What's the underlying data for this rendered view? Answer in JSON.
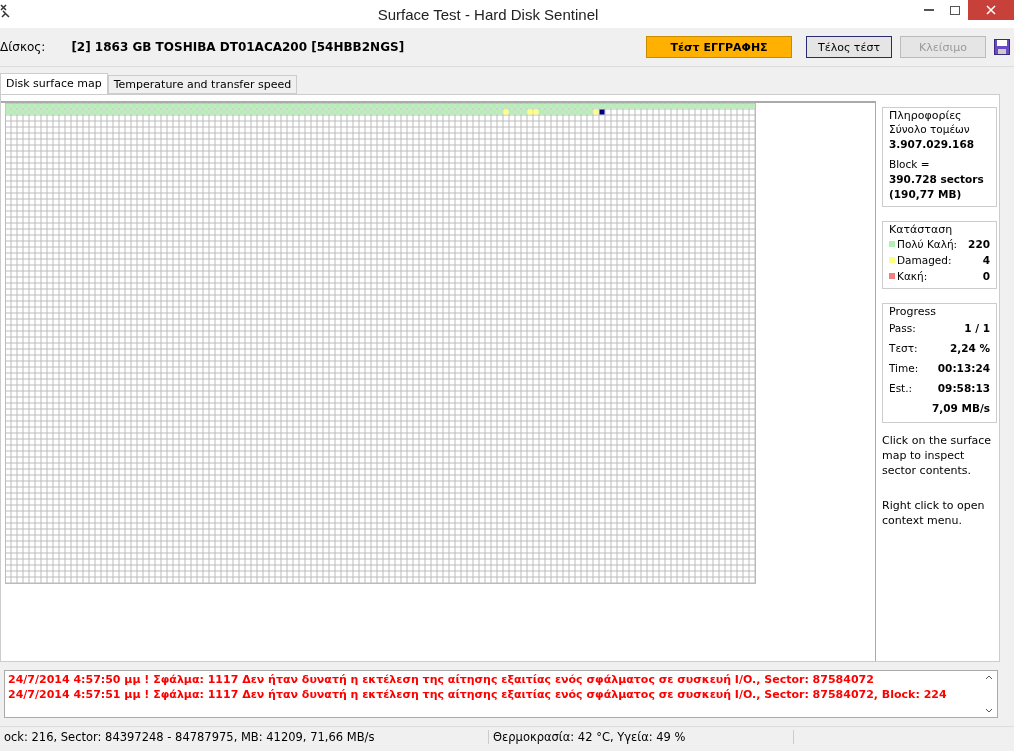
{
  "window": {
    "title": "Surface Test - Hard Disk Sentinel"
  },
  "toolbar": {
    "disk_label": "Δίσκος:",
    "disk": "[2] 1863 GB  TOSHIBA DT01ACA200 [54HBB2NGS]",
    "buttons": [
      {
        "label": "Τέστ ΕΓΓΡΑΦΗΣ",
        "kind": "highlight",
        "disabled": false
      },
      {
        "label": "Τέλος τέστ",
        "kind": "default",
        "disabled": false
      },
      {
        "label": "Κλείσιμο",
        "kind": "default",
        "disabled": true
      }
    ]
  },
  "tabs": [
    {
      "label": "Disk surface map",
      "selected": true
    },
    {
      "label": "Temperature and transfer speed",
      "selected": false
    }
  ],
  "surface_map": {
    "blocks": [
      {
        "kind": "good"
      },
      {
        "kind": "good"
      },
      {
        "kind": "good"
      },
      {
        "kind": "good"
      },
      {
        "kind": "good"
      },
      {
        "kind": "good"
      },
      {
        "kind": "good"
      },
      {
        "kind": "good"
      },
      {
        "kind": "good"
      },
      {
        "kind": "good"
      },
      {
        "kind": "good"
      },
      {
        "kind": "good"
      },
      {
        "kind": "good"
      },
      {
        "kind": "good"
      },
      {
        "kind": "good"
      },
      {
        "kind": "good"
      },
      {
        "kind": "good"
      },
      {
        "kind": "good"
      },
      {
        "kind": "good"
      },
      {
        "kind": "good"
      },
      {
        "kind": "good"
      },
      {
        "kind": "good"
      },
      {
        "kind": "good"
      },
      {
        "kind": "good"
      },
      {
        "kind": "good"
      },
      {
        "kind": "good"
      },
      {
        "kind": "good"
      },
      {
        "kind": "good"
      },
      {
        "kind": "good"
      },
      {
        "kind": "good"
      },
      {
        "kind": "good"
      },
      {
        "kind": "good"
      },
      {
        "kind": "good"
      },
      {
        "kind": "good"
      },
      {
        "kind": "good"
      },
      {
        "kind": "good"
      },
      {
        "kind": "good"
      },
      {
        "kind": "good"
      },
      {
        "kind": "good"
      },
      {
        "kind": "good"
      },
      {
        "kind": "good"
      },
      {
        "kind": "good"
      },
      {
        "kind": "good"
      },
      {
        "kind": "good"
      },
      {
        "kind": "good"
      },
      {
        "kind": "good"
      },
      {
        "kind": "good"
      },
      {
        "kind": "good"
      },
      {
        "kind": "good"
      },
      {
        "kind": "good"
      },
      {
        "kind": "good"
      },
      {
        "kind": "good"
      },
      {
        "kind": "good"
      },
      {
        "kind": "good"
      },
      {
        "kind": "good"
      },
      {
        "kind": "good"
      },
      {
        "kind": "good"
      },
      {
        "kind": "good"
      },
      {
        "kind": "good"
      },
      {
        "kind": "good"
      },
      {
        "kind": "good"
      },
      {
        "kind": "good"
      },
      {
        "kind": "good"
      },
      {
        "kind": "good"
      },
      {
        "kind": "good"
      },
      {
        "kind": "good"
      },
      {
        "kind": "good"
      },
      {
        "kind": "good"
      },
      {
        "kind": "good"
      },
      {
        "kind": "good"
      },
      {
        "kind": "good"
      },
      {
        "kind": "good"
      },
      {
        "kind": "good"
      },
      {
        "kind": "good"
      },
      {
        "kind": "good"
      },
      {
        "kind": "good"
      },
      {
        "kind": "good"
      },
      {
        "kind": "good"
      },
      {
        "kind": "good"
      },
      {
        "kind": "good"
      },
      {
        "kind": "good"
      },
      {
        "kind": "good"
      },
      {
        "kind": "good"
      },
      {
        "kind": "good"
      },
      {
        "kind": "good"
      },
      {
        "kind": "good"
      },
      {
        "kind": "good"
      },
      {
        "kind": "good"
      },
      {
        "kind": "good"
      },
      {
        "kind": "good"
      },
      {
        "kind": "good"
      },
      {
        "kind": "good"
      },
      {
        "kind": "good"
      },
      {
        "kind": "good"
      },
      {
        "kind": "good"
      },
      {
        "kind": "good"
      },
      {
        "kind": "good"
      },
      {
        "kind": "good"
      },
      {
        "kind": "good"
      },
      {
        "kind": "good"
      },
      {
        "kind": "good"
      },
      {
        "kind": "good"
      },
      {
        "kind": "good"
      },
      {
        "kind": "good"
      },
      {
        "kind": "good"
      },
      {
        "kind": "good"
      },
      {
        "kind": "good"
      },
      {
        "kind": "good"
      },
      {
        "kind": "good"
      },
      {
        "kind": "good"
      },
      {
        "kind": "good"
      },
      {
        "kind": "good"
      },
      {
        "kind": "good"
      },
      {
        "kind": "good"
      },
      {
        "kind": "good"
      },
      {
        "kind": "good"
      },
      {
        "kind": "good"
      },
      {
        "kind": "good"
      },
      {
        "kind": "good"
      },
      {
        "kind": "good"
      },
      {
        "kind": "good"
      },
      {
        "kind": "good"
      },
      {
        "kind": "good"
      },
      {
        "kind": "good"
      },
      {
        "kind": "good"
      },
      {
        "kind": "good"
      },
      {
        "kind": "good"
      },
      {
        "kind": "good"
      },
      {
        "kind": "good"
      },
      {
        "kind": "good"
      },
      {
        "kind": "good"
      },
      {
        "kind": "good"
      },
      {
        "kind": "good"
      },
      {
        "kind": "good"
      },
      {
        "kind": "good"
      },
      {
        "kind": "good"
      },
      {
        "kind": "good"
      },
      {
        "kind": "good"
      },
      {
        "kind": "good"
      },
      {
        "kind": "good"
      },
      {
        "kind": "good"
      },
      {
        "kind": "good"
      },
      {
        "kind": "good"
      },
      {
        "kind": "good"
      },
      {
        "kind": "good"
      },
      {
        "kind": "good"
      },
      {
        "kind": "good"
      },
      {
        "kind": "good"
      },
      {
        "kind": "good"
      },
      {
        "kind": "good"
      },
      {
        "kind": "good"
      },
      {
        "kind": "good"
      },
      {
        "kind": "good"
      },
      {
        "kind": "good"
      },
      {
        "kind": "good"
      },
      {
        "kind": "good"
      },
      {
        "kind": "good"
      },
      {
        "kind": "good"
      },
      {
        "kind": "good"
      },
      {
        "kind": "good"
      },
      {
        "kind": "good"
      },
      {
        "kind": "good"
      },
      {
        "kind": "good"
      },
      {
        "kind": "good"
      },
      {
        "kind": "good"
      },
      {
        "kind": "good"
      },
      {
        "kind": "good"
      },
      {
        "kind": "good"
      },
      {
        "kind": "good"
      },
      {
        "kind": "good"
      },
      {
        "kind": "good"
      },
      {
        "kind": "good"
      },
      {
        "kind": "good"
      },
      {
        "kind": "good"
      },
      {
        "kind": "good"
      },
      {
        "kind": "good"
      },
      {
        "kind": "good"
      },
      {
        "kind": "good"
      },
      {
        "kind": "good"
      },
      {
        "kind": "good"
      },
      {
        "kind": "good"
      },
      {
        "kind": "good"
      },
      {
        "kind": "good"
      },
      {
        "kind": "good"
      },
      {
        "kind": "good"
      },
      {
        "kind": "good"
      },
      {
        "kind": "good"
      },
      {
        "kind": "good"
      },
      {
        "kind": "good"
      },
      {
        "kind": "good"
      },
      {
        "kind": "good"
      },
      {
        "kind": "good"
      },
      {
        "kind": "good"
      },
      {
        "kind": "good"
      },
      {
        "kind": "good"
      },
      {
        "kind": "good"
      },
      {
        "kind": "good"
      },
      {
        "kind": "good"
      },
      {
        "kind": "good"
      },
      {
        "kind": "good"
      },
      {
        "kind": "good"
      },
      {
        "kind": "good"
      },
      {
        "kind": "good"
      },
      {
        "kind": "good"
      },
      {
        "kind": "good"
      },
      {
        "kind": "good"
      },
      {
        "kind": "good"
      },
      {
        "kind": "good"
      },
      {
        "kind": "damaged"
      },
      {
        "kind": "good"
      },
      {
        "kind": "good"
      },
      {
        "kind": "good"
      },
      {
        "kind": "damaged"
      },
      {
        "kind": "damaged"
      },
      {
        "kind": "good"
      },
      {
        "kind": "good"
      },
      {
        "kind": "good"
      },
      {
        "kind": "good"
      },
      {
        "kind": "good"
      },
      {
        "kind": "good"
      },
      {
        "kind": "good"
      },
      {
        "kind": "good"
      },
      {
        "kind": "good"
      },
      {
        "kind": "damaged"
      },
      {
        "kind": "current"
      }
    ]
  },
  "info": {
    "title": "Πληροφορίες",
    "total_label": "Σύνολο τομέων",
    "total": "3.907.029.168",
    "block_label": "Block =",
    "block_sectors": "390.728 sectors",
    "block_size": "(190,77 MB)"
  },
  "status": {
    "title": "Κατάσταση",
    "items": [
      {
        "label": "Πολύ Καλή:",
        "value": "220",
        "color": "#b4f0b4"
      },
      {
        "label": "Damaged:",
        "value": "4",
        "color": "#ffff80"
      },
      {
        "label": "Κακή:",
        "value": "0",
        "color": "#f08080"
      }
    ]
  },
  "progress": {
    "title": "Progress",
    "rows": [
      {
        "label": "Pass:",
        "value": "1 / 1"
      },
      {
        "label": "Τεστ:",
        "value": "2,24 %"
      },
      {
        "label": "Time:",
        "value": "00:13:24"
      },
      {
        "label": "Est.:",
        "value": "09:58:13"
      },
      {
        "label": "",
        "value": "7,09 MB/s"
      }
    ]
  },
  "hints": [
    "Click on the surface map to inspect sector contents.",
    "Right click to open context menu."
  ],
  "log": [
    "24/7/2014  4:57:50 μμ ! Σφάλμα: 1117 Δεν ήταν δυνατή η εκτέλεση της αίτησης εξαιτίας ενός σφάλματος σε συσκευή I/O., Sector: 87584072",
    "24/7/2014  4:57:51 μμ ! Σφάλμα: 1117 Δεν ήταν δυνατή η εκτέλεση της αίτησης εξαιτίας ενός σφάλματος σε συσκευή I/O., Sector: 87584072, Block: 224"
  ],
  "status_bar": [
    "ock: 216, Sector: 84397248 - 84787975, MB: 41209, 71,66 MB/s",
    "Θερμοκρασία: 42  °C,  Υγεία: 49 %"
  ]
}
